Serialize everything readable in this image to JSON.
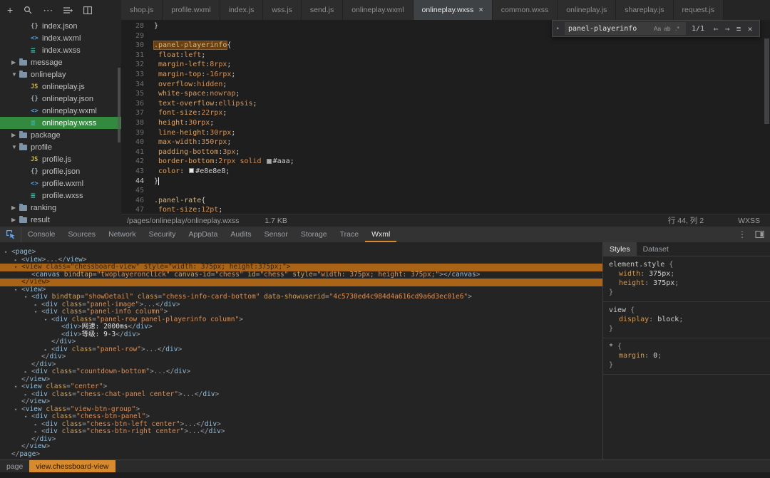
{
  "icons": {
    "plus": "+",
    "more": "⋯",
    "match_case": "Aa",
    "whole_word": "ab",
    "regex": ".*",
    "prev": "←",
    "next": "→",
    "find_menu": "≡",
    "close": "✕",
    "collapse": "▸",
    "dots_vertical": "⋮",
    "tab_close": "×"
  },
  "colors": {
    "accent_orange": "#d88a2e",
    "file_selection_green": "#338a3e",
    "tree_selection_orange": "#a96418"
  },
  "topbar": {
    "tabs": [
      {
        "label": "shop.js",
        "active": false
      },
      {
        "label": "profile.wxml",
        "active": false
      },
      {
        "label": "index.js",
        "active": false
      },
      {
        "label": "wss.js",
        "active": false
      },
      {
        "label": "send.js",
        "active": false
      },
      {
        "label": "onlineplay.wxml",
        "active": false
      },
      {
        "label": "onlineplay.wxss",
        "active": true
      },
      {
        "label": "common.wxss",
        "active": false
      },
      {
        "label": "onlineplay.js",
        "active": false
      },
      {
        "label": "shareplay.js",
        "active": false
      },
      {
        "label": "request.js",
        "active": false
      }
    ]
  },
  "sidebar": {
    "items": [
      {
        "indent": 2,
        "icon": "json",
        "label": "index.json"
      },
      {
        "indent": 2,
        "icon": "wxml",
        "label": "index.wxml"
      },
      {
        "indent": 2,
        "icon": "wxss",
        "label": "index.wxss"
      },
      {
        "indent": 1,
        "icon": "folder",
        "arrow": "right",
        "label": "message"
      },
      {
        "indent": 1,
        "icon": "folder",
        "arrow": "down",
        "label": "onlineplay"
      },
      {
        "indent": 2,
        "icon": "js",
        "label": "onlineplay.js"
      },
      {
        "indent": 2,
        "icon": "json",
        "label": "onlineplay.json"
      },
      {
        "indent": 2,
        "icon": "wxml",
        "label": "onlineplay.wxml"
      },
      {
        "indent": 2,
        "icon": "wxss",
        "label": "onlineplay.wxss",
        "selected": true
      },
      {
        "indent": 1,
        "icon": "folder",
        "arrow": "right",
        "label": "package"
      },
      {
        "indent": 1,
        "icon": "folder",
        "arrow": "down",
        "label": "profile"
      },
      {
        "indent": 2,
        "icon": "js",
        "label": "profile.js"
      },
      {
        "indent": 2,
        "icon": "json",
        "label": "profile.json"
      },
      {
        "indent": 2,
        "icon": "wxml",
        "label": "profile.wxml"
      },
      {
        "indent": 2,
        "icon": "wxss",
        "label": "profile.wxss"
      },
      {
        "indent": 1,
        "icon": "folder",
        "arrow": "right",
        "label": "ranking"
      },
      {
        "indent": 1,
        "icon": "folder",
        "arrow": "right",
        "label": "result"
      }
    ]
  },
  "editor": {
    "search": {
      "query": "panel-playerinfo",
      "count": "1/1"
    },
    "status": {
      "path": "/pages/onlineplay/onlineplay.wxss",
      "size": "1.7 KB",
      "cursor": "行 44, 列 2",
      "mode": "WXSS"
    },
    "lines": [
      {
        "n": "28",
        "toks": [
          [
            "}",
            "pu"
          ]
        ]
      },
      {
        "n": "29",
        "toks": []
      },
      {
        "n": "30",
        "toks": [
          [
            ".panel-playerinfo",
            "sel hl"
          ],
          [
            "{",
            "pu"
          ]
        ]
      },
      {
        "n": "31",
        "toks": [
          [
            " ",
            "pu"
          ],
          [
            "float",
            "prop"
          ],
          [
            ":",
            "pu"
          ],
          [
            "left",
            "val"
          ],
          [
            ";",
            "pu"
          ]
        ]
      },
      {
        "n": "32",
        "toks": [
          [
            " ",
            "pu"
          ],
          [
            "margin-left",
            "prop"
          ],
          [
            ":",
            "pu"
          ],
          [
            "8rpx",
            "val"
          ],
          [
            ";",
            "pu"
          ]
        ]
      },
      {
        "n": "33",
        "toks": [
          [
            " ",
            "pu"
          ],
          [
            "margin-top",
            "prop"
          ],
          [
            ":",
            "pu"
          ],
          [
            "-16rpx",
            "val"
          ],
          [
            ";",
            "pu"
          ]
        ]
      },
      {
        "n": "34",
        "toks": [
          [
            " ",
            "pu"
          ],
          [
            "overflow",
            "prop"
          ],
          [
            ":",
            "pu"
          ],
          [
            "hidden",
            "val"
          ],
          [
            ";",
            "pu"
          ]
        ]
      },
      {
        "n": "35",
        "toks": [
          [
            " ",
            "pu"
          ],
          [
            "white-space",
            "prop"
          ],
          [
            ":",
            "pu"
          ],
          [
            "nowrap",
            "val"
          ],
          [
            ";",
            "pu"
          ]
        ]
      },
      {
        "n": "36",
        "toks": [
          [
            " ",
            "pu"
          ],
          [
            "text-overflow",
            "prop"
          ],
          [
            ":",
            "pu"
          ],
          [
            "ellipsis",
            "val"
          ],
          [
            ";",
            "pu"
          ]
        ]
      },
      {
        "n": "37",
        "toks": [
          [
            " ",
            "pu"
          ],
          [
            "font-size",
            "prop"
          ],
          [
            ":",
            "pu"
          ],
          [
            "22rpx",
            "val"
          ],
          [
            ";",
            "pu"
          ]
        ]
      },
      {
        "n": "38",
        "toks": [
          [
            " ",
            "pu"
          ],
          [
            "height",
            "prop"
          ],
          [
            ":",
            "pu"
          ],
          [
            "30rpx",
            "val"
          ],
          [
            ";",
            "pu"
          ]
        ]
      },
      {
        "n": "39",
        "toks": [
          [
            " ",
            "pu"
          ],
          [
            "line-height",
            "prop"
          ],
          [
            ":",
            "pu"
          ],
          [
            "30rpx",
            "val"
          ],
          [
            ";",
            "pu"
          ]
        ]
      },
      {
        "n": "40",
        "toks": [
          [
            " ",
            "pu"
          ],
          [
            "max-width",
            "prop"
          ],
          [
            ":",
            "pu"
          ],
          [
            "350rpx",
            "val"
          ],
          [
            ";",
            "pu"
          ]
        ]
      },
      {
        "n": "41",
        "toks": [
          [
            " ",
            "pu"
          ],
          [
            "padding-bottom",
            "prop"
          ],
          [
            ":",
            "pu"
          ],
          [
            "3px",
            "val"
          ],
          [
            ";",
            "pu"
          ]
        ]
      },
      {
        "n": "42",
        "toks": [
          [
            " ",
            "pu"
          ],
          [
            "border-bottom",
            "prop"
          ],
          [
            ":",
            "pu"
          ],
          [
            "2rpx solid ",
            "val"
          ],
          [
            "#aaa",
            "chip"
          ],
          [
            "#aaa",
            "hex"
          ],
          [
            ";",
            "pu"
          ]
        ]
      },
      {
        "n": "43",
        "toks": [
          [
            " ",
            "pu"
          ],
          [
            "color",
            "prop"
          ],
          [
            ":",
            "pu"
          ],
          [
            " ",
            "pu"
          ],
          [
            "#e8e8e8",
            "chip"
          ],
          [
            "#e8e8e8",
            "hex"
          ],
          [
            ";",
            "pu"
          ]
        ]
      },
      {
        "n": "44",
        "cur": true,
        "toks": [
          [
            "}",
            "pu"
          ],
          [
            "",
            "caret"
          ]
        ]
      },
      {
        "n": "45",
        "toks": []
      },
      {
        "n": "46",
        "toks": [
          [
            ".panel-rate",
            "sel"
          ],
          [
            "{",
            "pu"
          ]
        ]
      },
      {
        "n": "47",
        "toks": [
          [
            " ",
            "pu"
          ],
          [
            "font-size",
            "prop"
          ],
          [
            ":",
            "pu"
          ],
          [
            "12pt",
            "val"
          ],
          [
            ";",
            "pu"
          ]
        ]
      }
    ]
  },
  "devtools": {
    "tabs": [
      "Console",
      "Sources",
      "Network",
      "Security",
      "AppData",
      "Audits",
      "Sensor",
      "Storage",
      "Trace",
      "Wxml"
    ],
    "active_tab": "Wxml",
    "tree": [
      {
        "i": 0,
        "a": "v",
        "t": "<page>"
      },
      {
        "i": 1,
        "a": "c",
        "t": "<view>...</view>"
      },
      {
        "i": 1,
        "a": "v",
        "h": true,
        "t": "<view class=\"chessboard-view\" style=\"width: 375px; height:375px;\">"
      },
      {
        "i": 2,
        "a": "",
        "t": "<canvas bindtap=\"twoplayeronclick\" canvas-id=\"chess\" id=\"chess\" style=\"width: 375px; height: 375px;\"></canvas>"
      },
      {
        "i": 1,
        "a": "",
        "h": true,
        "t": "</view>"
      },
      {
        "i": 1,
        "a": "v",
        "t": "<view>"
      },
      {
        "i": 2,
        "a": "v",
        "t": "<div bindtap=\"showDetail\" class=\"chess-info-card-bottom\" data-showuserid=\"4c5730ed4c984d4a616cd9a6d3ec01e6\">"
      },
      {
        "i": 3,
        "a": "c",
        "t": "<div class=\"panel-image\">...</div>"
      },
      {
        "i": 3,
        "a": "v",
        "t": "<div class=\"panel-info column\">"
      },
      {
        "i": 4,
        "a": "v",
        "t": "<div class=\"panel-row panel-playerinfo column\">"
      },
      {
        "i": 5,
        "a": "",
        "t": "<div>网速: 2000ms</div>"
      },
      {
        "i": 5,
        "a": "",
        "t": "<div>等级: 9-3</div>"
      },
      {
        "i": 4,
        "a": "",
        "t": "</div>"
      },
      {
        "i": 4,
        "a": "c",
        "t": "<div class=\"panel-row\">...</div>"
      },
      {
        "i": 3,
        "a": "",
        "t": "</div>"
      },
      {
        "i": 2,
        "a": "",
        "t": "</div>"
      },
      {
        "i": 2,
        "a": "c",
        "t": "<div class=\"countdown-bottom\">...</div>"
      },
      {
        "i": 1,
        "a": "",
        "t": "</view>"
      },
      {
        "i": 1,
        "a": "v",
        "t": "<view class=\"center\">"
      },
      {
        "i": 2,
        "a": "c",
        "t": "<div class=\"chess-chat-panel center\">...</div>"
      },
      {
        "i": 1,
        "a": "",
        "t": "</view>"
      },
      {
        "i": 1,
        "a": "v",
        "t": "<view class=\"view-btn-group\">"
      },
      {
        "i": 2,
        "a": "v",
        "t": "<div class=\"chess-btn-panel\">"
      },
      {
        "i": 3,
        "a": "c",
        "t": "<div class=\"chess-btn-left center\">...</div>"
      },
      {
        "i": 3,
        "a": "c",
        "t": "<div class=\"chess-btn-right center\">...</div>"
      },
      {
        "i": 2,
        "a": "",
        "t": "</div>"
      },
      {
        "i": 1,
        "a": "",
        "t": "</view>"
      },
      {
        "i": 0,
        "a": "",
        "t": "</page>"
      }
    ],
    "styles": {
      "tabs": [
        "Styles",
        "Dataset"
      ],
      "active_tab": "Styles",
      "rules": [
        {
          "selector": "element.style",
          "props": [
            [
              "width",
              "375px"
            ],
            [
              "height",
              "375px"
            ]
          ]
        },
        {
          "selector": "view",
          "props": [
            [
              "display",
              "block"
            ]
          ]
        },
        {
          "selector": "*",
          "props": [
            [
              "margin",
              "0"
            ]
          ]
        }
      ]
    },
    "breadcrumb": [
      {
        "label": "page",
        "active": false
      },
      {
        "label": "view.chessboard-view",
        "active": true
      }
    ]
  }
}
